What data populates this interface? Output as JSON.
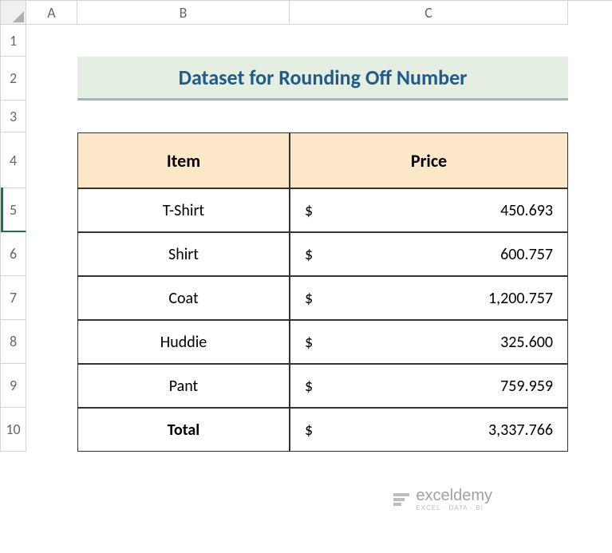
{
  "columns": [
    "A",
    "B",
    "C"
  ],
  "rows": [
    "1",
    "2",
    "3",
    "4",
    "5",
    "6",
    "7",
    "8",
    "9",
    "10"
  ],
  "title": "Dataset for Rounding Off Number",
  "headers": {
    "item": "Item",
    "price": "Price"
  },
  "data": [
    {
      "item": "T-Shirt",
      "currency": "$",
      "price": "450.693"
    },
    {
      "item": "Shirt",
      "currency": "$",
      "price": "600.757"
    },
    {
      "item": "Coat",
      "currency": "$",
      "price": "1,200.757"
    },
    {
      "item": "Huddie",
      "currency": "$",
      "price": "325.600"
    },
    {
      "item": "Pant",
      "currency": "$",
      "price": "759.959"
    }
  ],
  "total": {
    "label": "Total",
    "currency": "$",
    "price": "3,337.766"
  },
  "watermark": {
    "main": "exceldemy",
    "sub": "EXCEL · DATA · BI"
  }
}
